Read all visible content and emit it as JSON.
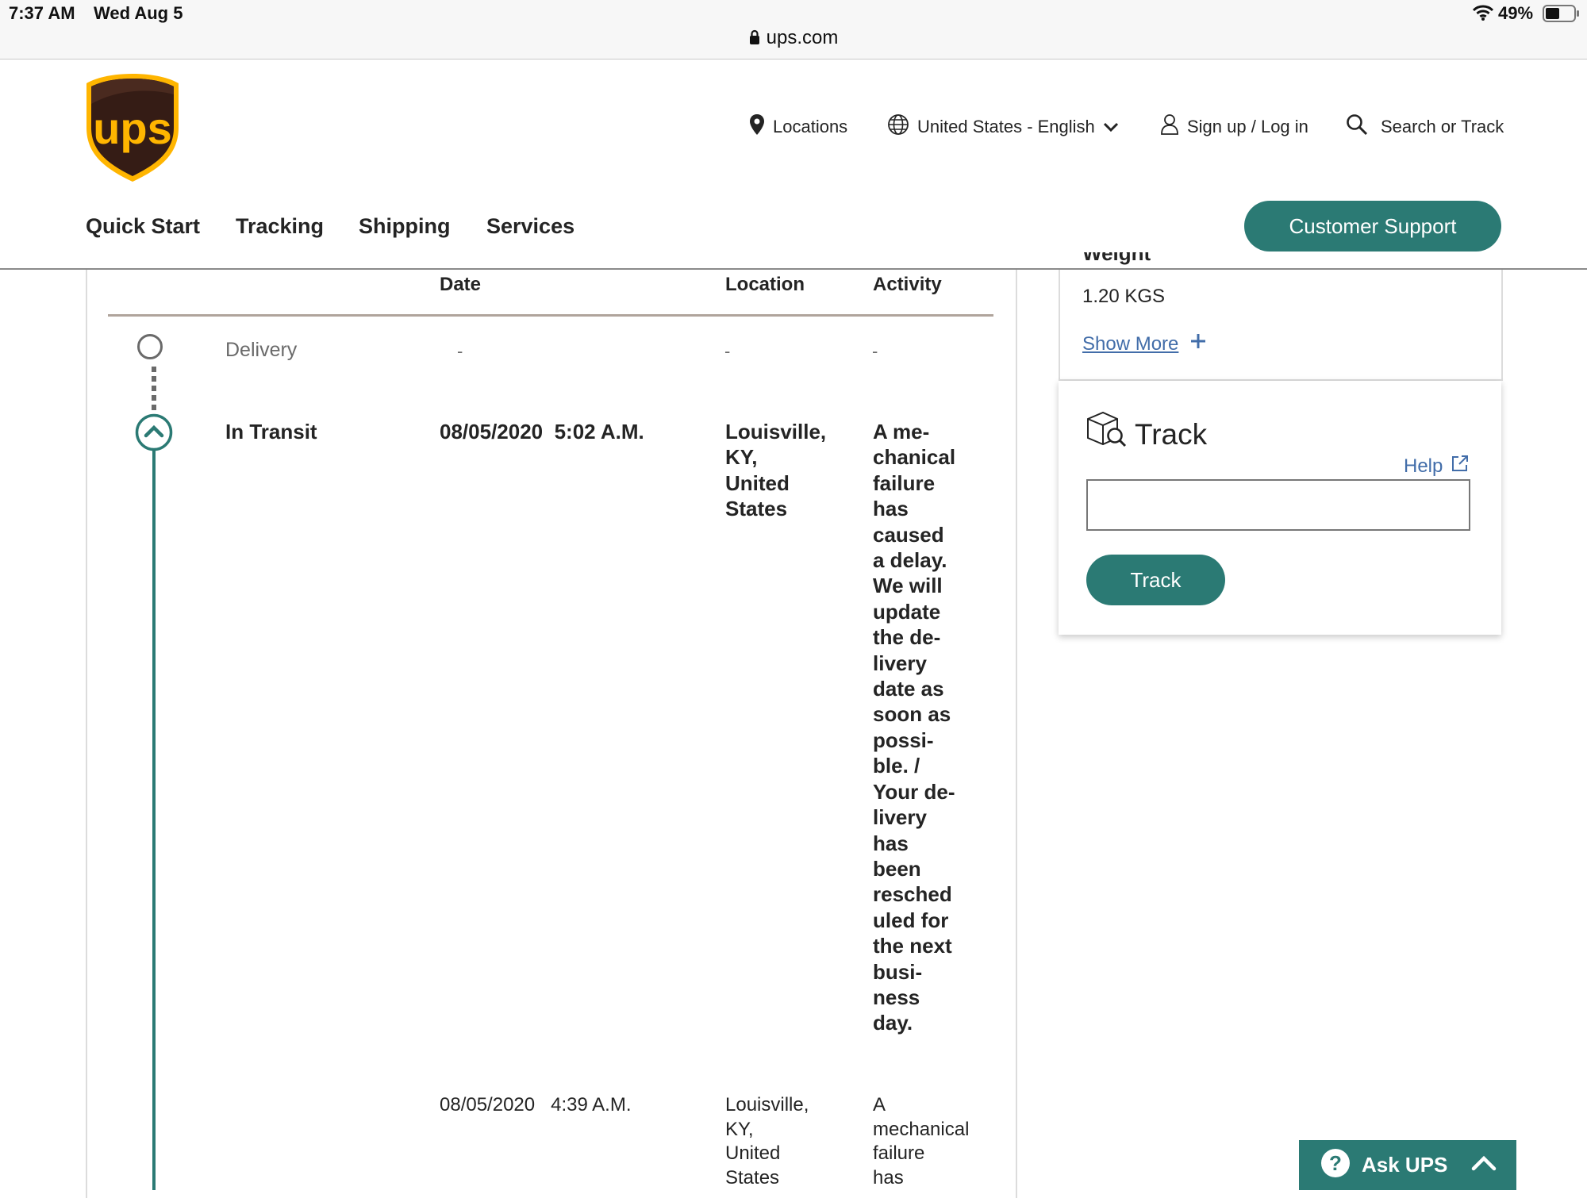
{
  "status_bar": {
    "time": "7:37 AM",
    "date": "Wed Aug 5",
    "url": "ups.com",
    "battery": "49%"
  },
  "header": {
    "logo_text": "ups",
    "utility": {
      "locations": "Locations",
      "language": "United States - English",
      "account": "Sign up / Log in",
      "search": "Search or Track"
    },
    "nav": [
      "Quick Start",
      "Tracking",
      "Shipping",
      "Services"
    ],
    "support_label": "Customer Support"
  },
  "table": {
    "headers": {
      "date": "Date",
      "location": "Location",
      "activity": "Activity"
    },
    "rows": [
      {
        "status": "Delivery",
        "date": "-",
        "location": "-",
        "activity": "-"
      },
      {
        "status": "In Transit",
        "date": "08/05/2020  5:02 A.M.",
        "location_lines": [
          "Louisville,",
          "KY,",
          "United",
          "States"
        ],
        "activity_lines": [
          "A me-",
          "chanical",
          "failure",
          "has",
          "caused",
          "a delay.",
          "We will",
          "update",
          "the de-",
          "livery",
          "date as",
          "soon as",
          "possi-",
          "ble. /",
          "Your de-",
          "livery",
          "has",
          "been",
          "resched",
          "uled for",
          "the next",
          "busi-",
          "ness",
          "day."
        ]
      },
      {
        "status": "",
        "date": "08/05/2020   4:39 A.M.",
        "location_lines": [
          "Louisville,",
          "KY,",
          "United",
          "States"
        ],
        "activity_lines": [
          "A",
          "mechanical",
          "failure",
          "has"
        ]
      }
    ]
  },
  "shipment": {
    "weight_label": "Weight",
    "weight_value": "1.20 KGS",
    "show_more": "Show More"
  },
  "track_widget": {
    "title": "Track",
    "help": "Help",
    "input_value": "",
    "button_label": "Track"
  },
  "ask_ups": {
    "label": "Ask UPS"
  },
  "colors": {
    "teal": "#2b7a74",
    "ups_brown": "#351c15",
    "ups_gold": "#ffb500",
    "link": "#426da9"
  }
}
